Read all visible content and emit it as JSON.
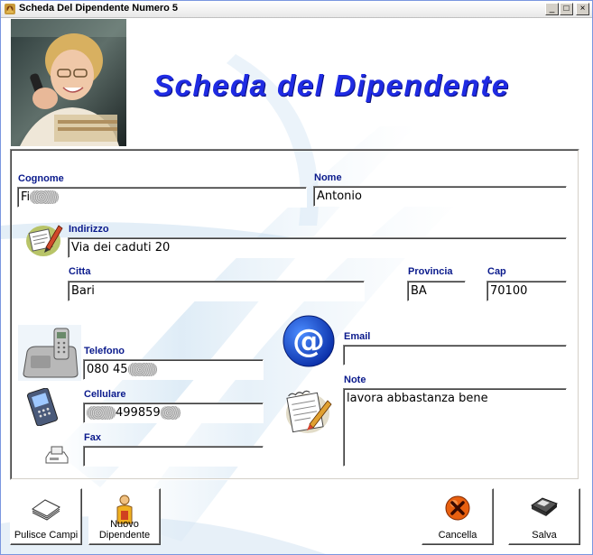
{
  "window": {
    "title": "Scheda Del Dipendente Numero 5"
  },
  "header": {
    "title": "Scheda del Dipendente"
  },
  "form": {
    "cognome": {
      "label": "Cognome",
      "value": "Fi"
    },
    "nome": {
      "label": "Nome",
      "value": "Antonio"
    },
    "indirizzo": {
      "label": "Indirizzo",
      "value": "Via dei caduti 20"
    },
    "citta": {
      "label": "Citta",
      "value": "Bari"
    },
    "provincia": {
      "label": "Provincia",
      "value": "BA"
    },
    "cap": {
      "label": "Cap",
      "value": "70100"
    },
    "telefono": {
      "label": "Telefono",
      "value": "080 45"
    },
    "cellulare": {
      "label": "Cellulare",
      "value": "499859"
    },
    "fax": {
      "label": "Fax",
      "value": ""
    },
    "email": {
      "label": "Email",
      "value": ""
    },
    "note": {
      "label": "Note",
      "value": "lavora abbastanza bene"
    }
  },
  "buttons": {
    "pulisci": "Pulisce Campi",
    "nuovo_line1": "Nuovo",
    "nuovo_line2": "Dipendente",
    "cancella": "Cancella",
    "salva": "Salva"
  },
  "colors": {
    "heading": "#1f2be3",
    "label": "#0a1a8c"
  },
  "icons": [
    "app-icon",
    "employee-photo",
    "notepad-pen-icon",
    "cordless-phone-icon",
    "cellphone-icon",
    "fax-icon",
    "email-at-icon",
    "note-pencil-icon",
    "clear-fields-icon",
    "new-employee-icon",
    "delete-icon",
    "save-floppy-icon"
  ]
}
